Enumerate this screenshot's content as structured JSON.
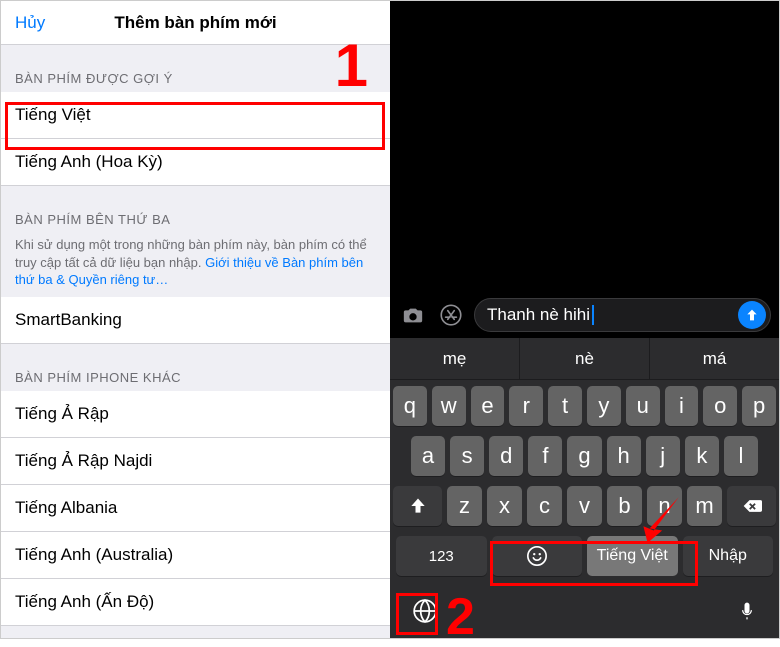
{
  "left": {
    "nav": {
      "cancel": "Hủy",
      "title": "Thêm bàn phím mới"
    },
    "suggested": {
      "header": "BÀN PHÍM ĐƯỢC GỢI Ý",
      "items": [
        "Tiếng Việt",
        "Tiếng Anh (Hoa Kỳ)"
      ]
    },
    "thirdparty": {
      "header": "BÀN PHÍM BÊN THỨ BA",
      "desc_prefix": "Khi sử dụng một trong những bàn phím này, bàn phím có thể truy cập tất cả dữ liệu bạn nhập. ",
      "desc_link": "Giới thiệu về Bàn phím bên thứ ba & Quyền riêng tư…",
      "items": [
        "SmartBanking"
      ]
    },
    "other": {
      "header": "BÀN PHÍM IPHONE KHÁC",
      "items": [
        "Tiếng Ả Rập",
        "Tiếng Ả Rập Najdi",
        "Tiếng Albania",
        "Tiếng Anh (Australia)",
        "Tiếng Anh (Ấn Độ)"
      ]
    }
  },
  "right": {
    "input_text": "Thanh nè hihi",
    "suggestions": [
      "mẹ",
      "nè",
      "má"
    ],
    "rows": {
      "r1": [
        "q",
        "w",
        "e",
        "r",
        "t",
        "y",
        "u",
        "i",
        "o",
        "p"
      ],
      "r2": [
        "a",
        "s",
        "d",
        "f",
        "g",
        "h",
        "j",
        "k",
        "l"
      ],
      "r3": [
        "z",
        "x",
        "c",
        "v",
        "b",
        "n",
        "m"
      ]
    },
    "key_123": "123",
    "spacebar": "Tiếng Việt",
    "return": "Nhập"
  },
  "annotations": {
    "one": "1",
    "two": "2"
  }
}
